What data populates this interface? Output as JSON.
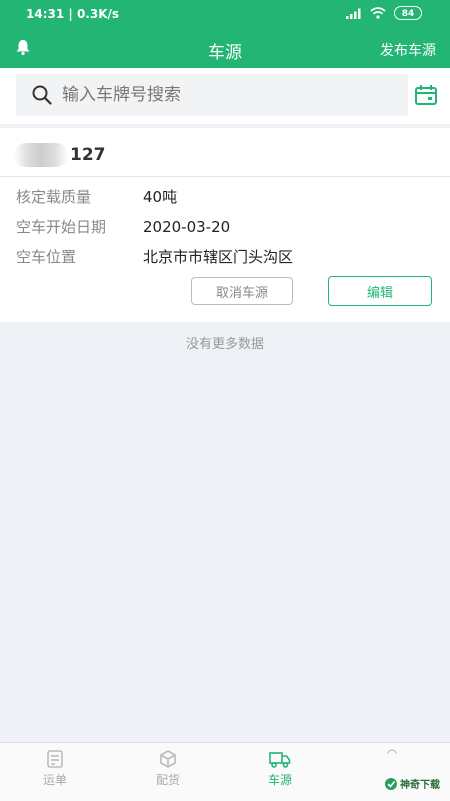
{
  "status_bar": {
    "time": "14:31",
    "speed": "| 0.3K/s",
    "battery": "84"
  },
  "header": {
    "title": "车源",
    "publish_label": "发布车源"
  },
  "search": {
    "placeholder": "输入车牌号搜索"
  },
  "vehicle": {
    "plate_suffix": "127",
    "fields": [
      {
        "label": "核定载质量",
        "value": "40吨"
      },
      {
        "label": "空车开始日期",
        "value": "2020-03-20"
      },
      {
        "label": "空车位置",
        "value": "北京市市辖区门头沟区"
      }
    ],
    "cancel_label": "取消车源",
    "edit_label": "编辑"
  },
  "list": {
    "no_more": "没有更多数据"
  },
  "tabs": [
    {
      "label": "运单",
      "icon": "document-icon"
    },
    {
      "label": "配货",
      "icon": "box-icon"
    },
    {
      "label": "车源",
      "icon": "truck-icon"
    }
  ],
  "watermark": {
    "text": "神奇下载"
  },
  "colors": {
    "primary": "#22b573",
    "background": "#eef1f5"
  }
}
